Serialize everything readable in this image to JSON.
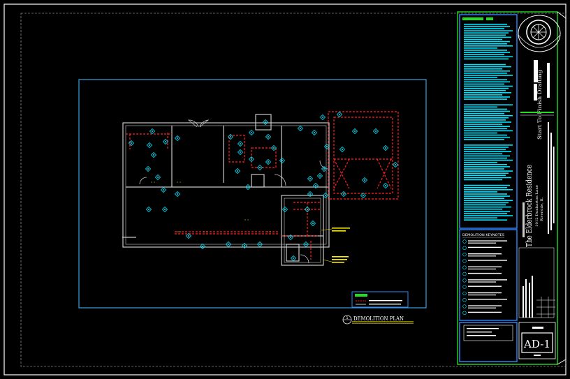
{
  "drawing": {
    "plan_title": "DEMOLITION PLAN",
    "plan_number": "1",
    "sheet_number": "AD-1"
  },
  "title_block": {
    "company": "Start To Finish Drafting",
    "project_name": "The Elderbrock Residence",
    "project_address": "1012 Dunbarton Lane",
    "city": "Riverside, IL"
  },
  "keynotes": {
    "header": "DEMOLITION KEYNOTES",
    "count": 12
  },
  "colors": {
    "background": "#000000",
    "walls": "#c8c8c8",
    "demolition": "#ff2020",
    "tags": "#00e5ff",
    "frame": "#ffffff",
    "accent_green": "#22dd22",
    "accent_yellow": "#ffee00",
    "panel_blue": "#3388ff"
  }
}
